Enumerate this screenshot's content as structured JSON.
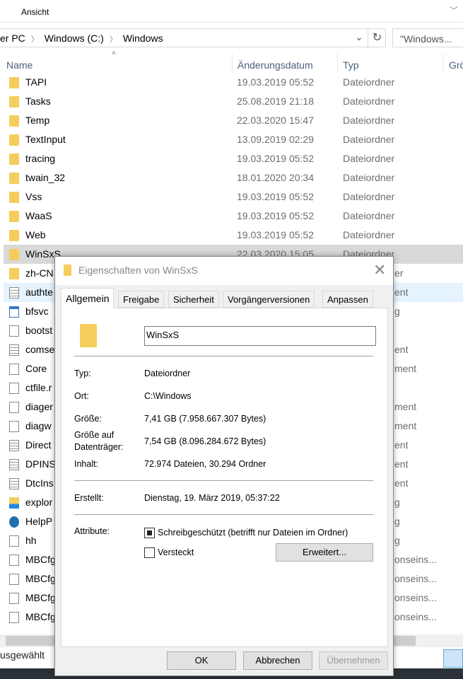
{
  "ribbon": {
    "tab": "Ansicht"
  },
  "address": {
    "crumbs": [
      "er PC",
      "Windows (C:)",
      "Windows"
    ]
  },
  "search": {
    "placeholder": "\"Windows..."
  },
  "columns": {
    "name": "Name",
    "date": "Änderungsdatum",
    "type": "Typ",
    "size": "Grö"
  },
  "rows": [
    {
      "name": "TAPI",
      "date": "19.03.2019 05:52",
      "type": "Dateiordner",
      "icon": "folder"
    },
    {
      "name": "Tasks",
      "date": "25.08.2019 21:18",
      "type": "Dateiordner",
      "icon": "folder"
    },
    {
      "name": "Temp",
      "date": "22.03.2020 15:47",
      "type": "Dateiordner",
      "icon": "folder"
    },
    {
      "name": "TextInput",
      "date": "13.09.2019 02:29",
      "type": "Dateiordner",
      "icon": "folder"
    },
    {
      "name": "tracing",
      "date": "19.03.2019 05:52",
      "type": "Dateiordner",
      "icon": "folder"
    },
    {
      "name": "twain_32",
      "date": "18.01.2020 20:34",
      "type": "Dateiordner",
      "icon": "folder"
    },
    {
      "name": "Vss",
      "date": "19.03.2019 05:52",
      "type": "Dateiordner",
      "icon": "folder"
    },
    {
      "name": "WaaS",
      "date": "19.03.2019 05:52",
      "type": "Dateiordner",
      "icon": "folder"
    },
    {
      "name": "Web",
      "date": "19.03.2019 05:52",
      "type": "Dateiordner",
      "icon": "folder"
    },
    {
      "name": "WinSxS",
      "date": "22.03.2020 15:05",
      "type": "Dateiordner",
      "icon": "folder",
      "selected": true
    },
    {
      "name": "zh-CN",
      "frag": "er",
      "icon": "folder"
    },
    {
      "name": "authte",
      "frag": "ent",
      "icon": "text",
      "hover": true
    },
    {
      "name": "bfsvc",
      "frag": "g",
      "icon": "app"
    },
    {
      "name": "bootst",
      "frag": "",
      "icon": "file"
    },
    {
      "name": "comse",
      "frag": "ent",
      "icon": "text"
    },
    {
      "name": "Core",
      "frag": "ment",
      "icon": "file"
    },
    {
      "name": "ctfile.r",
      "frag": "",
      "icon": "file"
    },
    {
      "name": "diager",
      "frag": "ment",
      "icon": "file"
    },
    {
      "name": "diagw",
      "frag": "ment",
      "icon": "file"
    },
    {
      "name": "Direct",
      "frag": "ent",
      "icon": "text"
    },
    {
      "name": "DPINS",
      "frag": "ent",
      "icon": "text"
    },
    {
      "name": "DtcIns",
      "frag": "ent",
      "icon": "text"
    },
    {
      "name": "explor",
      "frag": "g",
      "icon": "explorer"
    },
    {
      "name": "HelpP",
      "frag": "g",
      "icon": "help"
    },
    {
      "name": "hh",
      "frag": "g",
      "icon": "hh"
    },
    {
      "name": "MBCfg",
      "frag": "onseins...",
      "icon": "config"
    },
    {
      "name": "MBCfg",
      "frag": "onseins...",
      "icon": "config"
    },
    {
      "name": "MBCfg",
      "frag": "onseins...",
      "icon": "config"
    },
    {
      "name": "MBCfg",
      "frag": "onseins...",
      "icon": "config"
    }
  ],
  "status": {
    "text": "usgewählt"
  },
  "dialog": {
    "title": "Eigenschaften von WinSxS",
    "tabs": [
      "Allgemein",
      "Freigabe",
      "Sicherheit",
      "Vorgängerversionen",
      "Anpassen"
    ],
    "name": "WinSxS",
    "typ_label": "Typ:",
    "typ": "Dateiordner",
    "ort_label": "Ort:",
    "ort": "C:\\Windows",
    "groesse_label": "Größe:",
    "groesse": "7,41 GB (7.958.667.307 Bytes)",
    "disk_label1": "Größe auf",
    "disk_label2": "Datenträger:",
    "disk": "7,54 GB (8.096.284.672 Bytes)",
    "inhalt_label": "Inhalt:",
    "inhalt": "72.974 Dateien, 30.294 Ordner",
    "erstellt_label": "Erstellt:",
    "erstellt": "Dienstag, 19. März 2019, 05:37:22",
    "attr_label": "Attribute:",
    "readonly": "Schreibgeschützt (betrifft nur Dateien im Ordner)",
    "readonly_checked": "indeterminate",
    "hidden": "Versteckt",
    "hidden_checked": false,
    "advanced": "Erweitert...",
    "ok": "OK",
    "cancel": "Abbrechen",
    "apply": "Übernehmen"
  }
}
